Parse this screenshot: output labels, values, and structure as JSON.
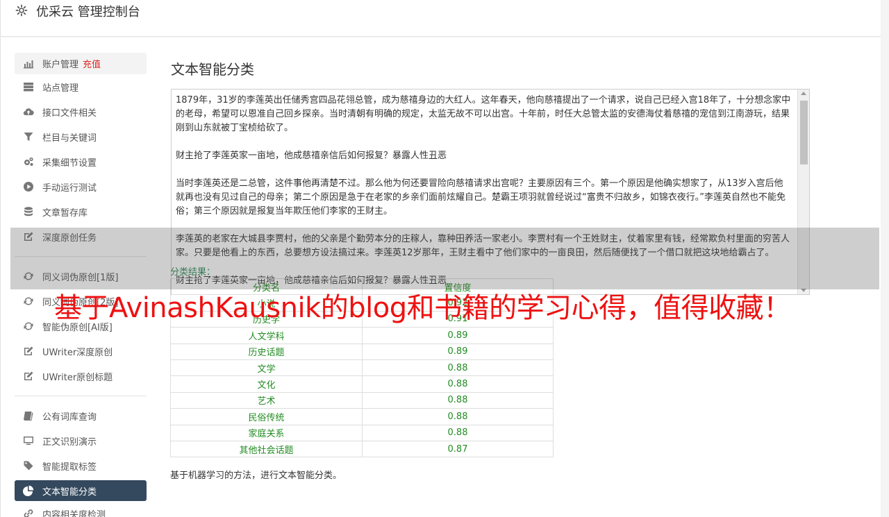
{
  "header": {
    "title": "优采云 管理控制台",
    "icon": "gear-icon"
  },
  "sidebar": {
    "group1": [
      {
        "label": "账户管理",
        "badge": "充值",
        "icon": "bar-chart-icon"
      },
      {
        "label": "站点管理",
        "icon": "server-icon"
      },
      {
        "label": "接口文件相关",
        "icon": "cloud-upload-icon"
      },
      {
        "label": "栏目与关键词",
        "icon": "filter-icon"
      },
      {
        "label": "采集细节设置",
        "icon": "gears-icon"
      },
      {
        "label": "手动运行测试",
        "icon": "play-circle-icon"
      },
      {
        "label": "文章暂存库",
        "icon": "database-icon"
      },
      {
        "label": "深度原创任务",
        "icon": "edit-icon"
      }
    ],
    "group2": [
      {
        "label": "同义词伪原创[1版]",
        "icon": "refresh-icon"
      },
      {
        "label": "同义词伪原创[2版]",
        "icon": "refresh-icon"
      },
      {
        "label": "智能伪原创[AI版]",
        "icon": "refresh-icon"
      },
      {
        "label": "UWriter深度原创",
        "icon": "edit-icon"
      },
      {
        "label": "UWriter原创标题",
        "icon": "edit-icon"
      }
    ],
    "group3": [
      {
        "label": "公有词库查询",
        "icon": "book-icon"
      },
      {
        "label": "正文识别演示",
        "icon": "desktop-icon"
      },
      {
        "label": "智能提取标签",
        "icon": "tag-icon"
      },
      {
        "label": "文本智能分类",
        "icon": "pie-chart-icon",
        "active": true
      },
      {
        "label": "内容相关度检测",
        "icon": "link-icon"
      }
    ]
  },
  "main": {
    "title": "文本智能分类",
    "textarea_paragraphs": [
      "1879年，31岁的李莲英出任储秀宫四品花翎总管，成为慈禧身边的大红人。这年春天，他向慈禧提出了一个请求，说自己已经入宫18年了，十分想念家中的老母，希望可以恩准自己回乡探亲。当时清朝有明确的规定，太监无故不可以出宫。十年前，时任大总管太监的安德海仗着慈禧的宠信到江南游玩，结果刚到山东就被丁宝桢给砍了。",
      "财主抢了李莲英家一亩地，他成慈禧亲信后如何报复？暴露人性丑恶",
      "当时李莲英还是二总管，这件事他再清楚不过。那么他为何还要冒险向慈禧请求出宫呢？主要原因有三个。第一个原因是他确实想家了，从13岁入宫后他就再也没有见过自己的母亲；第二个原因是急于在老家的乡亲们面前炫耀自己。楚霸王项羽就曾经说过“富贵不归故乡，如锦衣夜行。”李莲英自然也不能免俗；第三个原因就是报复当年欺压他们李家的王财主。",
      "李莲英的老家在大城县李贾村，他的父亲是个勤劳本分的庄稼人，靠种田养活一家老小。李贾村有一个王姓财主，仗着家里有钱，经常欺负村里面的穷苦人家。只要是他看上的东西，总要想方设法搞过来。李莲英12岁那年，王财主看中了他们家中的一亩良田，然后随便找了一个借口就把这块地给霸占了。",
      "财主抢了李莲英家一亩地，他成慈禧亲信后如何报复？暴露人性丑恶"
    ],
    "result_label": "分类结果：",
    "table": {
      "headers": [
        "分类名",
        "置信度"
      ],
      "rows": [
        [
          "小说",
          "0.92"
        ],
        [
          "历史学",
          "0.91"
        ],
        [
          "人文学科",
          "0.89"
        ],
        [
          "历史话题",
          "0.89"
        ],
        [
          "文学",
          "0.88"
        ],
        [
          "文化",
          "0.88"
        ],
        [
          "艺术",
          "0.88"
        ],
        [
          "民俗传统",
          "0.88"
        ],
        [
          "家庭关系",
          "0.88"
        ],
        [
          "其他社会话题",
          "0.87"
        ]
      ]
    },
    "footer_note": "基于机器学习的方法，进行文本智能分类。"
  },
  "watermark": "基于AvinashKausnik的blog和书籍的学习心得，值得收藏！",
  "colors": {
    "active_bg": "#34495e",
    "recharge": "#e02020",
    "result_green": "#228b22",
    "watermark": "#ee1111"
  }
}
